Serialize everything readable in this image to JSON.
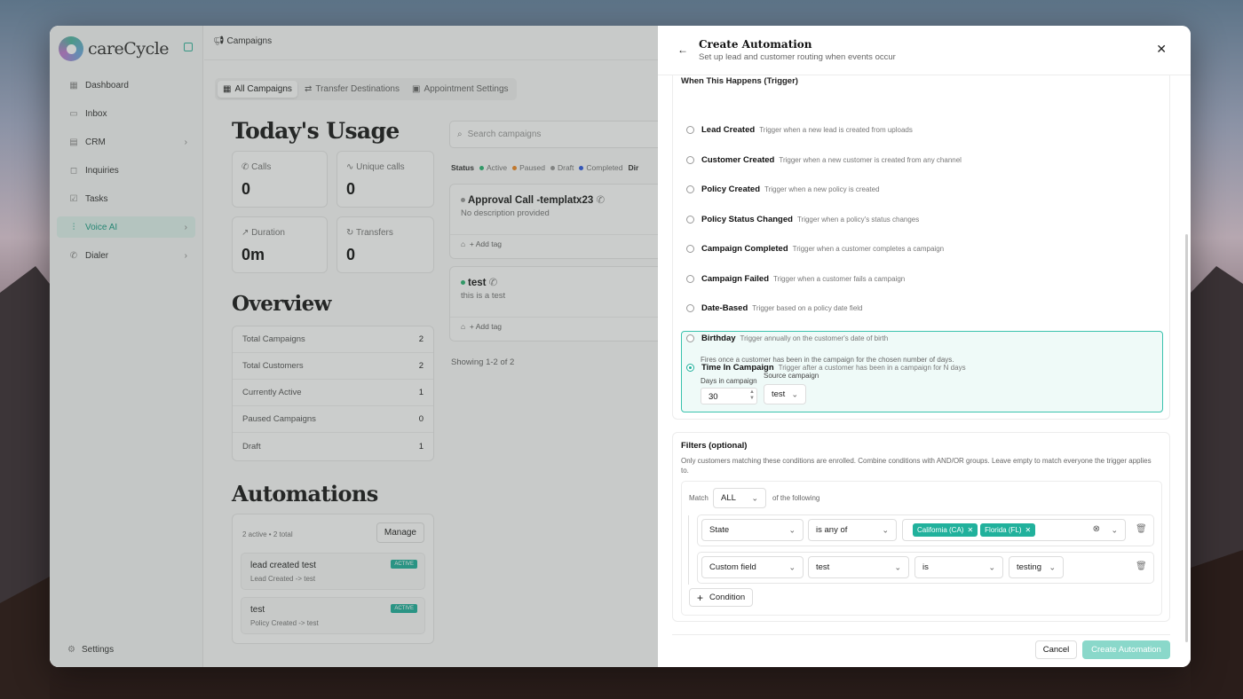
{
  "app": {
    "brand": "careCycle",
    "nav": [
      {
        "label": "Dashboard",
        "icon": "grid-icon",
        "glyph": "▦"
      },
      {
        "label": "Inbox",
        "icon": "inbox-icon",
        "glyph": "▭"
      },
      {
        "label": "CRM",
        "icon": "crm-icon",
        "glyph": "▤",
        "chevron": "›"
      },
      {
        "label": "Inquiries",
        "icon": "chat-icon",
        "glyph": "◻"
      },
      {
        "label": "Tasks",
        "icon": "check-icon",
        "glyph": "☑"
      },
      {
        "label": "Voice AI",
        "icon": "waveform-icon",
        "glyph": "⫶",
        "chevron": "›",
        "active": true
      },
      {
        "label": "Dialer",
        "icon": "phone-icon",
        "glyph": "✆",
        "chevron": "›"
      }
    ],
    "settings": "Settings",
    "breadcrumb": "Campaigns",
    "tabs": [
      "All Campaigns",
      "Transfer Destinations",
      "Appointment Settings"
    ],
    "usage": {
      "title": "Today's Usage",
      "cards": [
        {
          "label": "Calls",
          "value": "0"
        },
        {
          "label": "Unique calls",
          "value": "0"
        },
        {
          "label": "Duration",
          "value": "0m"
        },
        {
          "label": "Transfers",
          "value": "0"
        }
      ]
    },
    "overview": {
      "title": "Overview",
      "rows": [
        {
          "label": "Total Campaigns",
          "value": "2"
        },
        {
          "label": "Total Customers",
          "value": "2"
        },
        {
          "label": "Currently Active",
          "value": "1"
        },
        {
          "label": "Paused Campaigns",
          "value": "0"
        },
        {
          "label": "Draft",
          "value": "1"
        }
      ]
    },
    "automations": {
      "title": "Automations",
      "summary": "2 active • 2 total",
      "manage": "Manage",
      "items": [
        {
          "name": "lead created test",
          "sub": "Lead Created -> test",
          "badge": "ACTIVE"
        },
        {
          "name": "test",
          "sub": "Policy Created -> test",
          "badge": "ACTIVE"
        }
      ]
    },
    "search_placeholder": "Search campaigns",
    "status": {
      "label": "Status",
      "items": [
        {
          "label": "Active",
          "color": "#2bb673"
        },
        {
          "label": "Paused",
          "color": "#f08a24"
        },
        {
          "label": "Draft",
          "color": "#999999"
        },
        {
          "label": "Completed",
          "color": "#2f5be0"
        }
      ],
      "trailing": "Dir"
    },
    "campaigns": [
      {
        "name": "Approval Call -templatx23",
        "desc": "No description provided",
        "dot": "#999999",
        "tag": "+ Add tag"
      },
      {
        "name": "test",
        "desc": "this is a test",
        "dot": "#2bb673",
        "tag": "+ Add tag"
      }
    ],
    "showing": "Showing 1-2 of 2"
  },
  "panel": {
    "title": "Create Automation",
    "subtitle": "Set up lead and customer routing when events occur",
    "trigger_title": "When This Happens (Trigger)",
    "options": [
      {
        "name": "Lead Created",
        "desc": "Trigger when a new lead is created from uploads"
      },
      {
        "name": "Customer Created",
        "desc": "Trigger when a new customer is created from any channel"
      },
      {
        "name": "Policy Created",
        "desc": "Trigger when a new policy is created"
      },
      {
        "name": "Policy Status Changed",
        "desc": "Trigger when a policy's status changes"
      },
      {
        "name": "Campaign Completed",
        "desc": "Trigger when a customer completes a campaign"
      },
      {
        "name": "Campaign Failed",
        "desc": "Trigger when a customer fails a campaign"
      },
      {
        "name": "Date-Based",
        "desc": "Trigger based on a policy date field"
      },
      {
        "name": "Birthday",
        "desc": "Trigger annually on the customer's date of birth"
      },
      {
        "name": "Time In Campaign",
        "desc": "Trigger after a customer has been in a campaign for N days",
        "selected": true
      }
    ],
    "time_in_campaign": {
      "note": "Fires once a customer has been in the campaign for the chosen number of days.",
      "days_label": "Days in campaign",
      "days_value": "30",
      "source_label": "Source campaign",
      "source_value": "test"
    },
    "filters": {
      "title": "Filters (optional)",
      "desc": "Only customers matching these conditions are enrolled. Combine conditions with AND/OR groups. Leave empty to match everyone the trigger applies to.",
      "match_label": "Match",
      "match_value": "ALL",
      "following": "of the following",
      "cond1": {
        "field": "State",
        "op": "is any of",
        "chips": [
          "California (CA)",
          "Florida (FL)"
        ]
      },
      "cond2": {
        "field": "Custom field",
        "name": "test",
        "op": "is",
        "value": "testing"
      },
      "add_condition": "Condition"
    },
    "cancel": "Cancel",
    "create": "Create Automation"
  }
}
